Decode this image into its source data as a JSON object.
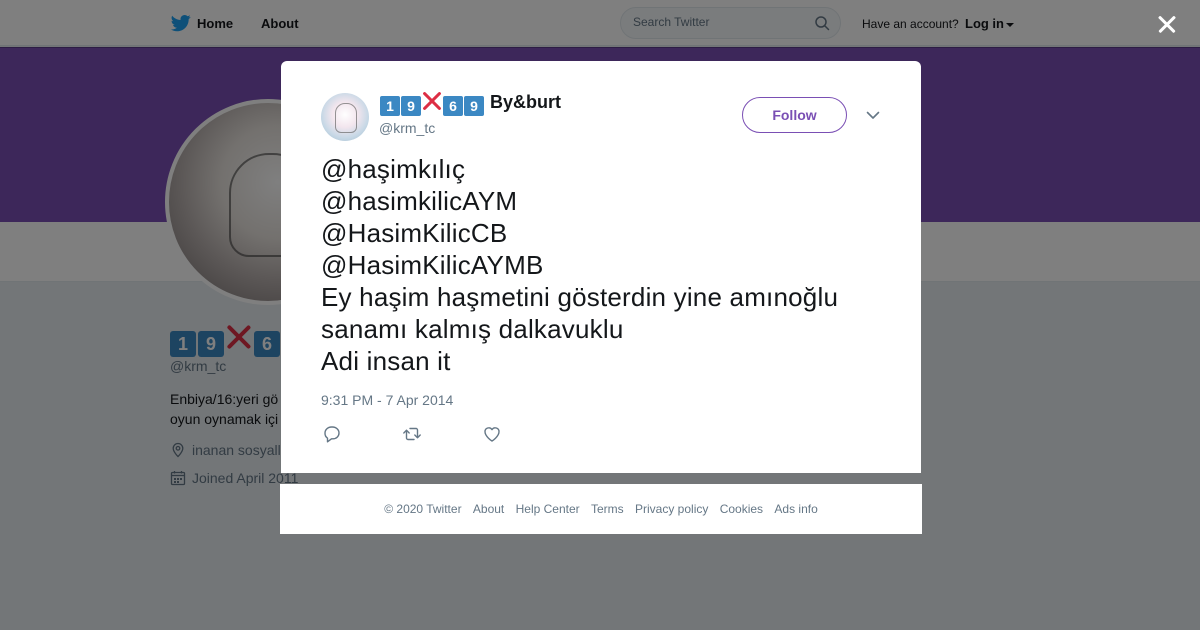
{
  "nav": {
    "home_label": "Home",
    "about_label": "About",
    "search_placeholder": "Search Twitter",
    "have_account": "Have an account?",
    "login_label": "Log in"
  },
  "profile": {
    "display_name_emoji": [
      "1",
      "9",
      "x",
      "6"
    ],
    "handle": "@krm_tc",
    "bio_visible": [
      "Enbiya/16:yeri gö",
      "oyun oynamak içi"
    ],
    "location_visible": "inanan sosyall",
    "joined": "Joined April 2011"
  },
  "tweet": {
    "author_name_emoji": [
      "1",
      "9",
      "x",
      "6",
      "9"
    ],
    "author_name_text": "By&burt",
    "author_handle": "@krm_tc",
    "follow_label": "Follow",
    "lines": [
      "@haşimkılıç",
      "@hasimkilicAYM",
      "@HasimKilicCB",
      "@HasimKilicAYMB",
      "Ey haşim haşmetini gösterdin yine amınoğlu",
      "sanamı kalmış dalkavuklu",
      "Adi insan it"
    ],
    "timestamp": "9:31 PM - 7 Apr 2014"
  },
  "footer": {
    "links": [
      "© 2020 Twitter",
      "About",
      "Help Center",
      "Terms",
      "Privacy policy",
      "Cookies",
      "Ads info"
    ]
  },
  "colors": {
    "brand_blue": "#1da1f2",
    "profile_accent": "#7a4fb4",
    "keycap_blue": "#3b88c3",
    "cross_red": "#dd2e44"
  },
  "icons": {
    "logo": "twitter-bird-icon",
    "search": "search-icon",
    "close": "close-icon",
    "more": "chevron-down-icon",
    "reply": "reply-icon",
    "retweet": "retweet-icon",
    "like": "heart-icon",
    "location": "location-pin-icon",
    "calendar": "calendar-icon"
  }
}
